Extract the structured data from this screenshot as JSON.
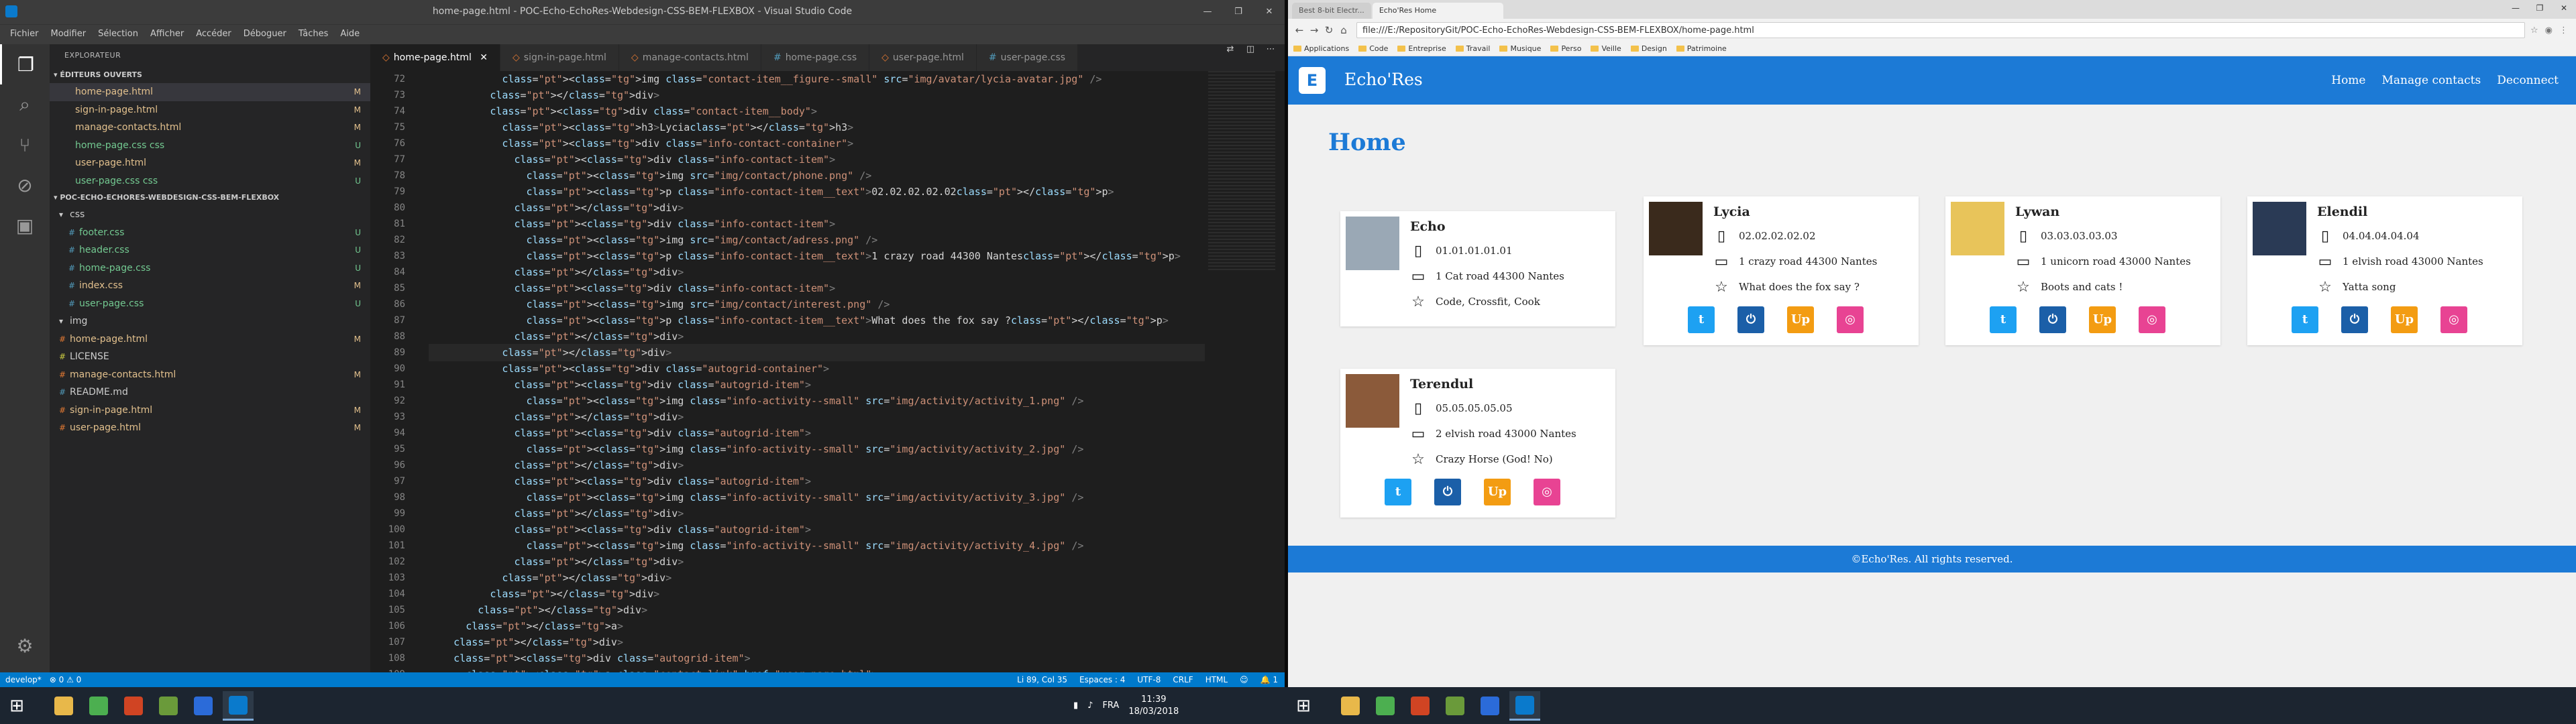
{
  "vscode": {
    "title": "home-page.html - POC-Echo-EchoRes-Webdesign-CSS-BEM-FLEXBOX - Visual Studio Code",
    "menu": [
      "Fichier",
      "Modifier",
      "Sélection",
      "Afficher",
      "Accéder",
      "Déboguer",
      "Tâches",
      "Aide"
    ],
    "explorer_title": "EXPLORATEUR",
    "open_editors_title": "ÉDITEURS OUVERTS",
    "open_editors": [
      {
        "name": "home-page.html",
        "status": "M",
        "kind": "html"
      },
      {
        "name": "sign-in-page.html",
        "status": "M",
        "kind": "html"
      },
      {
        "name": "manage-contacts.html",
        "status": "M",
        "kind": "html"
      },
      {
        "name": "home-page.css css",
        "status": "U",
        "kind": "css"
      },
      {
        "name": "user-page.html",
        "status": "M",
        "kind": "html"
      },
      {
        "name": "user-page.css css",
        "status": "U",
        "kind": "css"
      }
    ],
    "project_title": "POC-ECHO-ECHORES-WEBDESIGN-CSS-BEM-FLEXBOX",
    "tree": [
      {
        "name": "css",
        "status": "",
        "kind": "folder",
        "depth": 1
      },
      {
        "name": "footer.css",
        "status": "U",
        "kind": "css",
        "depth": 2
      },
      {
        "name": "header.css",
        "status": "U",
        "kind": "css",
        "depth": 2
      },
      {
        "name": "home-page.css",
        "status": "U",
        "kind": "css",
        "depth": 2
      },
      {
        "name": "index.css",
        "status": "M",
        "kind": "css",
        "depth": 2
      },
      {
        "name": "user-page.css",
        "status": "U",
        "kind": "css",
        "depth": 2
      },
      {
        "name": "img",
        "status": "",
        "kind": "folder",
        "depth": 1
      },
      {
        "name": "home-page.html",
        "status": "M",
        "kind": "html",
        "depth": 1
      },
      {
        "name": "LICENSE",
        "status": "",
        "kind": "license",
        "depth": 1
      },
      {
        "name": "manage-contacts.html",
        "status": "M",
        "kind": "html",
        "depth": 1
      },
      {
        "name": "README.md",
        "status": "",
        "kind": "md",
        "depth": 1
      },
      {
        "name": "sign-in-page.html",
        "status": "M",
        "kind": "html",
        "depth": 1
      },
      {
        "name": "user-page.html",
        "status": "M",
        "kind": "html",
        "depth": 1
      }
    ],
    "tabs": [
      {
        "label": "home-page.html",
        "kind": "html",
        "active": true
      },
      {
        "label": "sign-in-page.html",
        "kind": "html",
        "active": false
      },
      {
        "label": "manage-contacts.html",
        "kind": "html",
        "active": false
      },
      {
        "label": "home-page.css",
        "kind": "css",
        "active": false
      },
      {
        "label": "user-page.html",
        "kind": "html",
        "active": false
      },
      {
        "label": "user-page.css",
        "kind": "css",
        "active": false
      }
    ],
    "first_line": 72,
    "current_line": 89,
    "code_lines": [
      "            <img class=\"contact-item__figure--small\" src=\"img/avatar/lycia-avatar.jpg\" />",
      "          </div>",
      "          <div class=\"contact-item__body\">",
      "            <h3>Lycia</h3>",
      "            <div class=\"info-contact-container\">",
      "              <div class=\"info-contact-item\">",
      "                <img src=\"img/contact/phone.png\" />",
      "                <p class=\"info-contact-item__text\">02.02.02.02.02</p>",
      "              </div>",
      "              <div class=\"info-contact-item\">",
      "                <img src=\"img/contact/adress.png\" />",
      "                <p class=\"info-contact-item__text\">1 crazy road 44300 Nantes</p>",
      "              </div>",
      "              <div class=\"info-contact-item\">",
      "                <img src=\"img/contact/interest.png\" />",
      "                <p class=\"info-contact-item__text\">What does the fox say ?</p>",
      "              </div>",
      "            </div>",
      "            <div class=\"autogrid-container\">",
      "              <div class=\"autogrid-item\">",
      "                <img class=\"info-activity--small\" src=\"img/activity/activity_1.png\" />",
      "              </div>",
      "              <div class=\"autogrid-item\">",
      "                <img class=\"info-activity--small\" src=\"img/activity/activity_2.jpg\" />",
      "              </div>",
      "              <div class=\"autogrid-item\">",
      "                <img class=\"info-activity--small\" src=\"img/activity/activity_3.jpg\" />",
      "              </div>",
      "              <div class=\"autogrid-item\">",
      "                <img class=\"info-activity--small\" src=\"img/activity/activity_4.jpg\" />",
      "              </div>",
      "            </div>",
      "          </div>",
      "        </div>",
      "      </a>",
      "    </div>",
      "    <div class=\"autogrid-item\">",
      "      <a class=\"contact-link\" href=\"user-page.html\">"
    ],
    "status_left": [
      "develop*",
      "⊗ 0 ⚠ 0"
    ],
    "status_right": [
      "Li 89, Col 35",
      "Espaces : 4",
      "UTF-8",
      "CRLF",
      "HTML",
      "☺",
      "🔔 1"
    ]
  },
  "chrome": {
    "tabs": [
      "Best 8-bit Electr...",
      "Echo'Res Home"
    ],
    "window_controls": [
      "—",
      "❐",
      "✕"
    ],
    "url": "file:///E:/RepositoryGit/POC-Echo-EchoRes-Webdesign-CSS-BEM-FLEXBOX/home-page.html",
    "bookmarks": [
      "Applications",
      "Code",
      "Entreprise",
      "Travail",
      "Musique",
      "Perso",
      "Veille",
      "Design",
      "Patrimoine"
    ]
  },
  "site": {
    "brand": "Echo'Res",
    "logo_letter": "E",
    "nav": [
      "Home",
      "Manage contacts",
      "Deconnect"
    ],
    "page_title": "Home",
    "contacts": [
      {
        "name": "Echo",
        "phone": "01.01.01.01.01",
        "address": "1 Cat road 44300 Nantes",
        "interest": "Code, Crossfit, Cook",
        "avatar_color": "#9aa8b5",
        "has_acts": false
      },
      {
        "name": "Lycia",
        "phone": "02.02.02.02.02",
        "address": "1 crazy road 44300 Nantes",
        "interest": "What does the fox say ?",
        "avatar_color": "#3a2a1c",
        "has_acts": true
      },
      {
        "name": "Lywan",
        "phone": "03.03.03.03.03",
        "address": "1 unicorn road 43000 Nantes",
        "interest": "Boots and cats !",
        "avatar_color": "#e8c45a",
        "has_acts": true
      },
      {
        "name": "Elendil",
        "phone": "04.04.04.04.04",
        "address": "1 elvish road 43000 Nantes",
        "interest": "Yatta song",
        "avatar_color": "#2a3a55",
        "has_acts": true
      },
      {
        "name": "Terendul",
        "phone": "05.05.05.05.05",
        "address": "2 elvish road 43000 Nantes",
        "interest": "Crazy Horse (God! No)",
        "avatar_color": "#8b5a3a",
        "has_acts": true
      }
    ],
    "activities": [
      {
        "label": "t",
        "color": "#1da1f2",
        "icon": "twitter-icon"
      },
      {
        "label": "⏻",
        "color": "#1b5fa8",
        "icon": "power-icon"
      },
      {
        "label": "Up",
        "color": "#f39c12",
        "icon": "up-icon"
      },
      {
        "label": "◎",
        "color": "#e84393",
        "icon": "instagram-icon"
      }
    ],
    "footer": "©Echo'Res. All rights reserved."
  },
  "taskbar": {
    "lang": "FRA",
    "time": "11:39",
    "date": "18/03/2018",
    "apps": [
      {
        "name": "file-explorer",
        "color": "#e8b84a"
      },
      {
        "name": "chrome",
        "color": "#4caf50"
      },
      {
        "name": "powerpoint",
        "color": "#d04423"
      },
      {
        "name": "minecraft",
        "color": "#6a9a3a"
      },
      {
        "name": "maps",
        "color": "#2b6bd9"
      },
      {
        "name": "vscode",
        "color": "#0a7acc"
      }
    ]
  }
}
